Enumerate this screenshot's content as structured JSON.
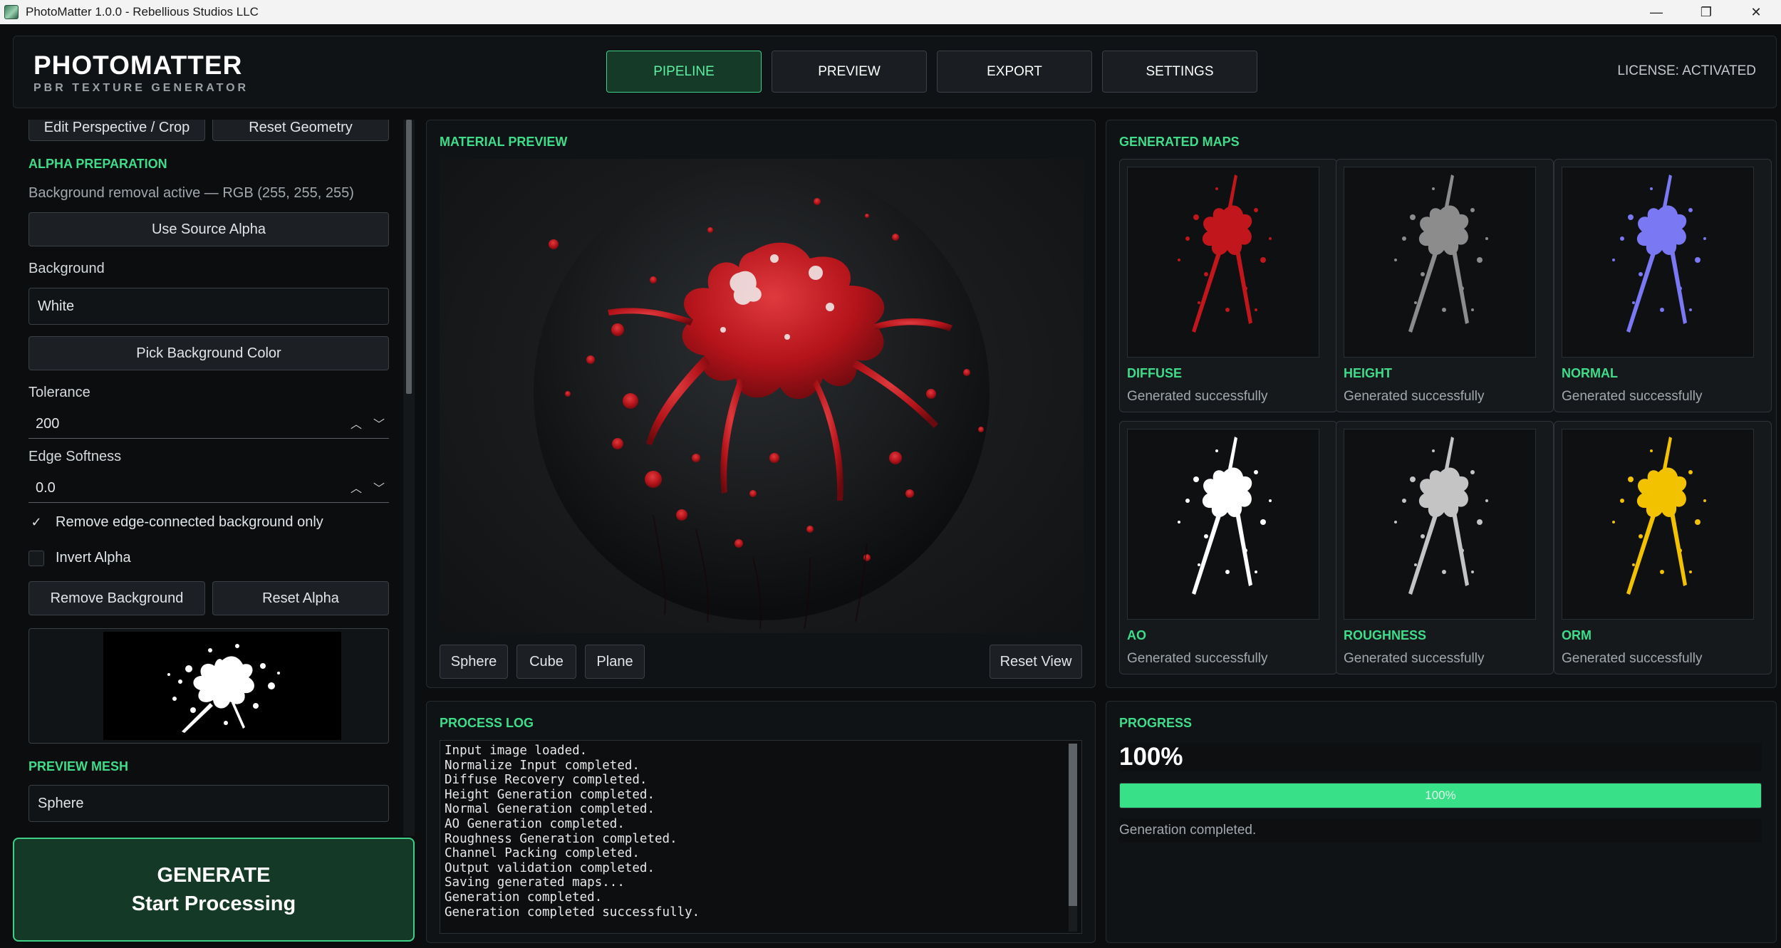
{
  "window": {
    "title": "PhotoMatter 1.0.0 - Rebellious Studios LLC",
    "minimize_glyph": "—",
    "restore_glyph": "❐",
    "close_glyph": "✕"
  },
  "header": {
    "app_name": "PHOTOMATTER",
    "subtitle": "PBR TEXTURE GENERATOR",
    "tabs": [
      {
        "label": "PIPELINE",
        "active": true
      },
      {
        "label": "PREVIEW",
        "active": false
      },
      {
        "label": "EXPORT",
        "active": false
      },
      {
        "label": "SETTINGS",
        "active": false
      }
    ],
    "license": "LICENSE: ACTIVATED"
  },
  "left_panel": {
    "geometry_buttons": {
      "edit": "Edit Perspective / Crop",
      "reset": "Reset Geometry"
    },
    "alpha_section_title": "ALPHA PREPARATION",
    "alpha_status": "Background removal active — RGB (255, 255, 255)",
    "use_source_alpha": "Use Source Alpha",
    "background_label": "Background",
    "background_value": "White",
    "pick_background": "Pick Background Color",
    "tolerance_label": "Tolerance",
    "tolerance_value": "200",
    "edge_softness_label": "Edge Softness",
    "edge_softness_value": "0.0",
    "remove_edge_only": {
      "label": "Remove edge-connected background only",
      "checked": true
    },
    "invert_alpha": {
      "label": "Invert Alpha",
      "checked": false
    },
    "remove_background": "Remove Background",
    "reset_alpha": "Reset Alpha",
    "preview_mesh_title": "PREVIEW MESH",
    "preview_mesh_value": "Sphere",
    "check_glyph": "✓",
    "spin_up": "︿",
    "spin_down": "﹀"
  },
  "generate": {
    "line1": "GENERATE",
    "line2": "Start Processing"
  },
  "material_preview": {
    "title": "MATERIAL PREVIEW",
    "mesh_buttons": [
      "Sphere",
      "Cube",
      "Plane"
    ],
    "reset_view": "Reset View"
  },
  "generated_maps": {
    "title": "GENERATED MAPS",
    "maps": [
      {
        "name": "DIFFUSE",
        "status": "Generated successfully",
        "color": "#c0161c"
      },
      {
        "name": "HEIGHT",
        "status": "Generated successfully",
        "color": "#8c8c8c"
      },
      {
        "name": "NORMAL",
        "status": "Generated successfully",
        "color": "#7a78f2"
      },
      {
        "name": "AO",
        "status": "Generated successfully",
        "color": "#ffffff"
      },
      {
        "name": "ROUGHNESS",
        "status": "Generated successfully",
        "color": "#c4c4c4"
      },
      {
        "name": "ORM",
        "status": "Generated successfully",
        "color": "#f2c200"
      }
    ]
  },
  "process_log": {
    "title": "PROCESS LOG",
    "lines": [
      "Input image loaded.",
      "Normalize Input completed.",
      "Diffuse Recovery completed.",
      "Height Generation completed.",
      "Normal Generation completed.",
      "AO Generation completed.",
      "Roughness Generation completed.",
      "Channel Packing completed.",
      "Output validation completed.",
      "Saving generated maps...",
      "Generation completed.",
      "Generation completed successfully."
    ]
  },
  "progress": {
    "title": "PROGRESS",
    "percent_text": "100%",
    "value": 1.0,
    "bar_text": "100%",
    "status": "Generation completed."
  },
  "colors": {
    "accent": "#3fdc8a",
    "accent_fill": "#38e088",
    "blood": "#b3131a"
  }
}
